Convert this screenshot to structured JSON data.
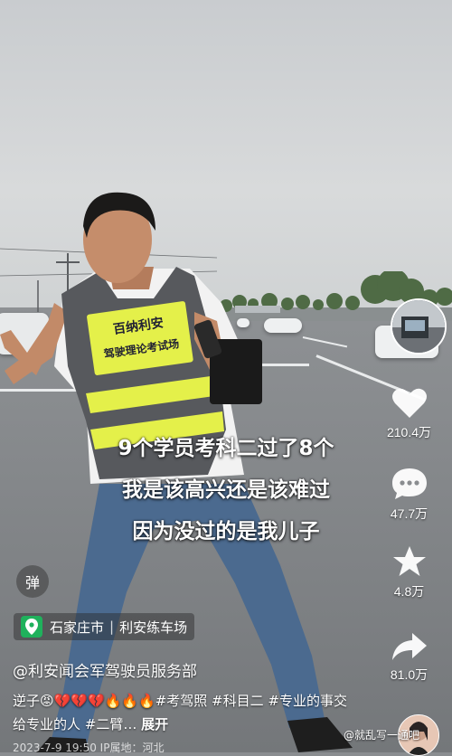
{
  "video": {
    "caption_lines": [
      "9个学员考科二过了8个",
      "我是该高兴还是该难过",
      "因为没过的是我儿子"
    ],
    "vest": {
      "line1": "百纳利安",
      "line2": "驾驶理论考试场"
    }
  },
  "actions": {
    "like_count": "210.4万",
    "comment_count": "47.7万",
    "favorite_count": "4.8万",
    "share_count": "81.0万"
  },
  "danmu_label": "弹",
  "location": {
    "city": "石家庄市",
    "place": "利安练车场"
  },
  "author": "@利安闻会军驾驶员服务部",
  "description": {
    "text": "逆子😡💔💔💔🔥🔥🔥#考驾照 #科目二 #专业的事交给专业的人 #二臂…",
    "more": "展开"
  },
  "footer_meta": "2023-7-9 19:50 IP属地：河北",
  "watermark": "@就乱写一通吧",
  "colors": {
    "location_icon": "#1fb15c",
    "vest_yellow": "#e4f04a"
  }
}
